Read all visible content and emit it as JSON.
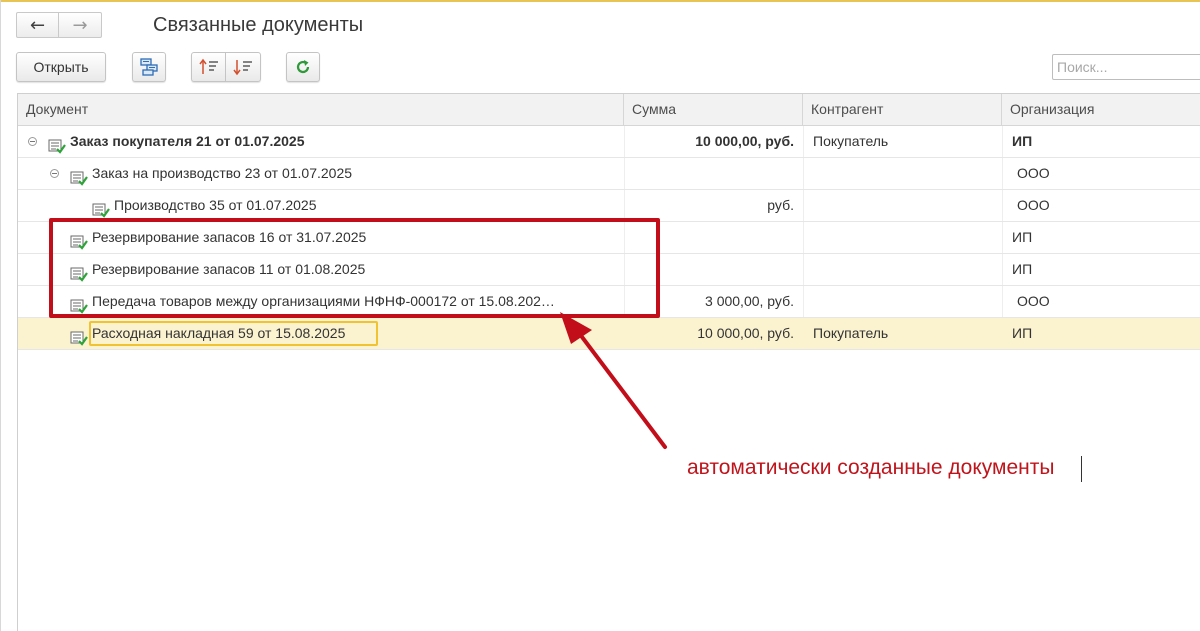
{
  "window": {
    "title": "Связанные документы",
    "accent_color": "#e8c454"
  },
  "nav": {
    "back_icon": "arrow-left-icon",
    "forward_icon": "arrow-right-icon",
    "back_glyph": "←",
    "forward_glyph": "→"
  },
  "toolbar": {
    "open_label": "Открыть",
    "structure_icon": "document-structure-icon",
    "sort_asc_icon": "sort-ascending-icon",
    "sort_desc_icon": "sort-descending-icon",
    "refresh_icon": "refresh-icon"
  },
  "search": {
    "placeholder": "Поиск...",
    "value": ""
  },
  "table": {
    "columns": [
      "Документ",
      "Сумма",
      "Контрагент",
      "Организация"
    ],
    "rows": [
      {
        "name": "Заказ покупателя 21 от 01.07.2025",
        "sum": "10 000,00, руб.",
        "counterparty": "Покупатель",
        "org": "ИП",
        "level": 0,
        "expandable": true,
        "bold": true,
        "selected": false
      },
      {
        "name": "Заказ на производство 23 от 01.07.2025",
        "sum": "",
        "counterparty": "",
        "org": "ООО",
        "level": 1,
        "expandable": true,
        "bold": false,
        "selected": false
      },
      {
        "name": "Производство 35 от 01.07.2025",
        "sum": "руб.",
        "counterparty": "",
        "org": "ООО",
        "level": 2,
        "expandable": false,
        "bold": false,
        "selected": false
      },
      {
        "name": "Резервирование запасов 16 от 31.07.2025",
        "sum": "",
        "counterparty": "",
        "org": "ИП",
        "level": 1,
        "expandable": false,
        "bold": false,
        "selected": false
      },
      {
        "name": "Резервирование запасов 11 от 01.08.2025",
        "sum": "",
        "counterparty": "",
        "org": "ИП",
        "level": 1,
        "expandable": false,
        "bold": false,
        "selected": false
      },
      {
        "name": "Передача товаров между организациями НФНФ-000172 от 15.08.202…",
        "sum": "3 000,00, руб.",
        "counterparty": "",
        "org": "ООО",
        "level": 1,
        "expandable": false,
        "bold": false,
        "selected": false
      },
      {
        "name": "Расходная накладная 59 от 15.08.2025",
        "sum": "10 000,00, руб.",
        "counterparty": "Покупатель",
        "org": "ИП",
        "level": 1,
        "expandable": false,
        "bold": false,
        "selected": true
      }
    ],
    "selected_row_color": "#fbf2cf",
    "focus_color": "#f1c232"
  },
  "annotation": {
    "text": "автоматически созданные документы",
    "color": "#c0141c"
  }
}
